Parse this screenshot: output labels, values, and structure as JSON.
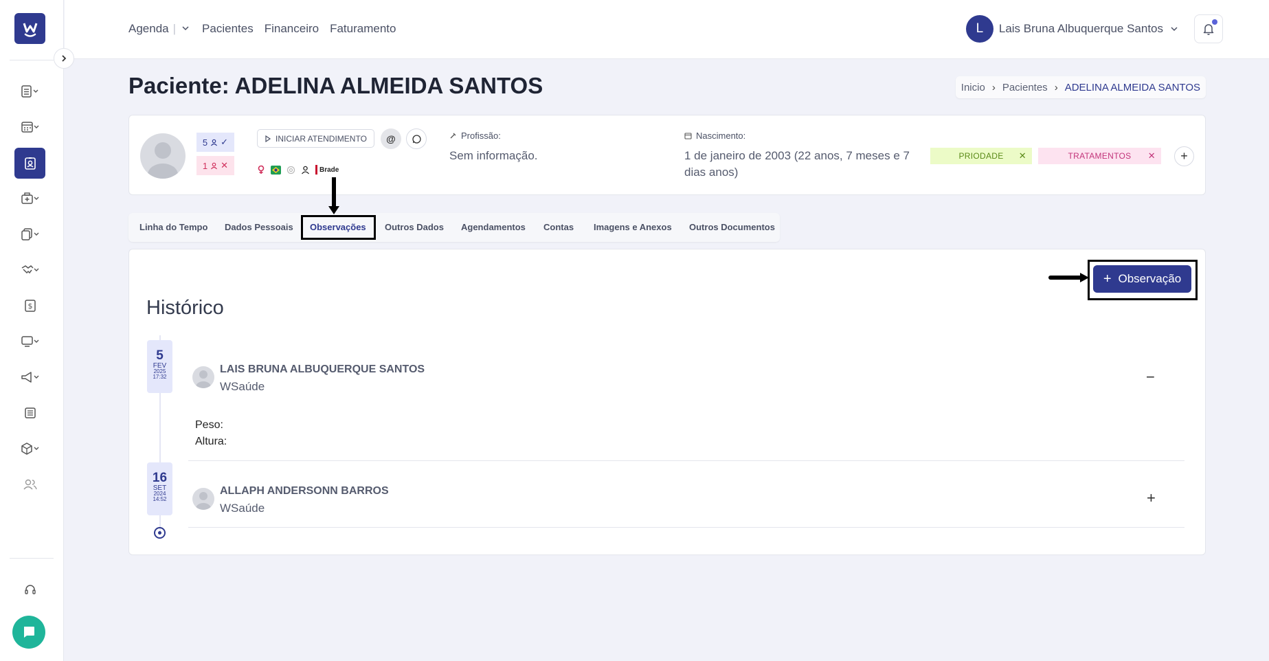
{
  "nav": {
    "items": [
      "Agenda",
      "Pacientes",
      "Financeiro",
      "Faturamento"
    ],
    "separator": "|"
  },
  "user": {
    "initial": "L",
    "name": "Lais Bruna Albuquerque Santos"
  },
  "page": {
    "title": "Paciente: ADELINA ALMEIDA SANTOS"
  },
  "breadcrumb": {
    "items": [
      "Inicio",
      "Pacientes"
    ],
    "current": "ADELINA ALMEIDA SANTOS"
  },
  "patient": {
    "badge_green_count": "5",
    "badge_red_count": "1",
    "start_button": "INICIAR ATENDIMENTO",
    "email_symbol": "@",
    "insurance_text": "Brade",
    "profession_label": "Profissão:",
    "profession_value": "Sem informação.",
    "birth_label": "Nascimento:",
    "birth_value": "1 de janeiro de 2003 (22 anos, 7 meses e 7 dias anos)",
    "tags": [
      {
        "label": "PRIODADE",
        "bg": "#ecfbc7",
        "color": "#5a8a17"
      },
      {
        "label": "TRATAMENTOS",
        "bg": "#fde3f0",
        "color": "#c2347a"
      }
    ],
    "add_symbol": "+"
  },
  "tabs": [
    {
      "label": "Linha do Tempo",
      "active": false
    },
    {
      "label": "Dados Pessoais",
      "active": false
    },
    {
      "label": "Observações",
      "active": true
    },
    {
      "label": "Outros Dados",
      "active": false
    },
    {
      "label": "Agendamentos",
      "active": false
    },
    {
      "label": "Contas",
      "active": false
    },
    {
      "label": "Imagens e Anexos",
      "active": false
    },
    {
      "label": "Outros Documentos",
      "active": false
    }
  ],
  "main": {
    "add_button": "Observação",
    "history_title": "Histórico",
    "entries": [
      {
        "day": "5",
        "month": "FEV",
        "year": "2025",
        "time": "17:32",
        "author": "LAIS BRUNA ALBUQUERQUE SANTOS",
        "org": "WSaúde",
        "toggle": "−",
        "expanded": true,
        "body": [
          "Peso:",
          "Altura:"
        ]
      },
      {
        "day": "16",
        "month": "SET",
        "year": "2024",
        "time": "14:52",
        "author": "ALLAPH ANDERSONN BARROS",
        "org": "WSaúde",
        "toggle": "+",
        "expanded": false
      }
    ]
  },
  "colors": {
    "primary": "#2f3a8f",
    "chat": "#1fb59a",
    "background": "#f1f2f9"
  },
  "icons": {
    "sidebar": [
      "list-icon",
      "calendar-icon",
      "patient-card-icon",
      "medical-kit-icon",
      "documents-icon",
      "handshake-icon",
      "dollar-icon",
      "monitor-icon",
      "megaphone-icon",
      "newspaper-icon",
      "box-icon",
      "users-icon",
      "headset-icon"
    ]
  }
}
